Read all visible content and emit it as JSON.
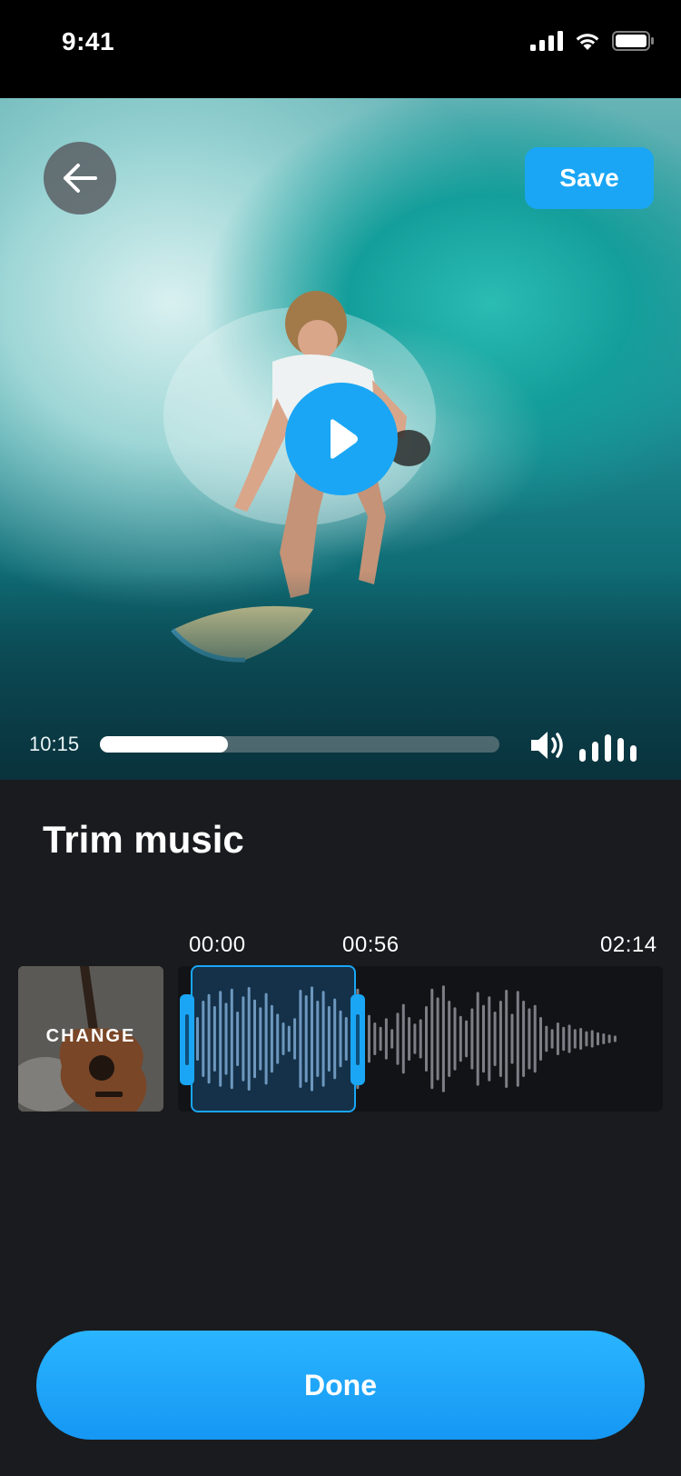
{
  "status_bar": {
    "time": "9:41"
  },
  "video": {
    "save_label": "Save",
    "current_time": "10:15",
    "progress_fraction": 0.32,
    "volume_level_bars": 5
  },
  "trim": {
    "title": "Trim music",
    "markers": {
      "start": "00:00",
      "selection_end": "00:56",
      "total": "02:14"
    },
    "change_label": "CHANGE"
  },
  "done_label": "Done",
  "colors": {
    "accent": "#1aa6f5",
    "background": "#1a1b1e"
  },
  "icons": [
    "back-arrow-icon",
    "play-icon",
    "volume-icon",
    "volume-level-icon",
    "cellular-signal-icon",
    "wifi-icon",
    "battery-icon"
  ]
}
